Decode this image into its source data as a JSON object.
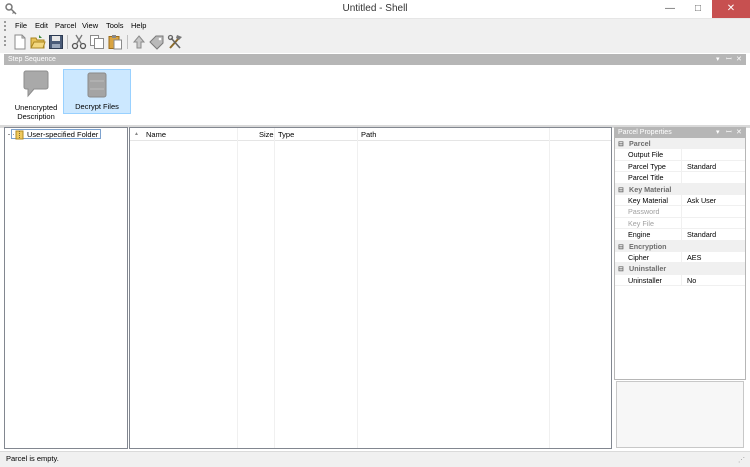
{
  "window": {
    "title": "Untitled - Shell",
    "controls": {
      "minimize": "—",
      "maximize": "□",
      "close": "✕"
    }
  },
  "menu": [
    "File",
    "Edit",
    "Parcel",
    "View",
    "Tools",
    "Help"
  ],
  "toolbar": {
    "buttons": [
      "new-icon",
      "open-icon",
      "save-icon",
      "cut-icon",
      "copy-icon",
      "paste-icon",
      "up-icon",
      "tag-icon",
      "tools-icon"
    ]
  },
  "step_sequence": {
    "title": "Step Sequence",
    "steps": [
      {
        "label_line1": "Unencrypted",
        "label_line2": "Description",
        "selected": false
      },
      {
        "label_line1": "Decrypt Files",
        "label_line2": "",
        "selected": true
      }
    ]
  },
  "tree": {
    "root_label": "User-specified Folder"
  },
  "file_list": {
    "columns": [
      "Name",
      "Size",
      "Type",
      "Path"
    ],
    "sort_indicator": "▲",
    "rows": []
  },
  "properties": {
    "title": "Parcel Properties",
    "categories": [
      {
        "name": "Parcel",
        "items": [
          {
            "name": "Output File",
            "value": "",
            "disabled": false
          },
          {
            "name": "Parcel Type",
            "value": "Standard",
            "disabled": false
          },
          {
            "name": "Parcel Title",
            "value": "",
            "disabled": false
          }
        ]
      },
      {
        "name": "Key Material",
        "items": [
          {
            "name": "Key Material",
            "value": "Ask User",
            "disabled": false
          },
          {
            "name": "Password",
            "value": "",
            "disabled": true
          },
          {
            "name": "Key File",
            "value": "",
            "disabled": true
          },
          {
            "name": "Engine",
            "value": "Standard",
            "disabled": false
          }
        ]
      },
      {
        "name": "Encryption",
        "items": [
          {
            "name": "Cipher",
            "value": "AES",
            "disabled": false
          }
        ]
      },
      {
        "name": "Uninstaller",
        "items": [
          {
            "name": "Uninstaller",
            "value": "No",
            "disabled": false
          }
        ]
      }
    ]
  },
  "status": {
    "text": "Parcel is empty."
  },
  "colors": {
    "panel_header": "#b6b6b6",
    "selection": "#cce8ff",
    "selection_border": "#7da2ce",
    "close_button": "#c75050"
  }
}
